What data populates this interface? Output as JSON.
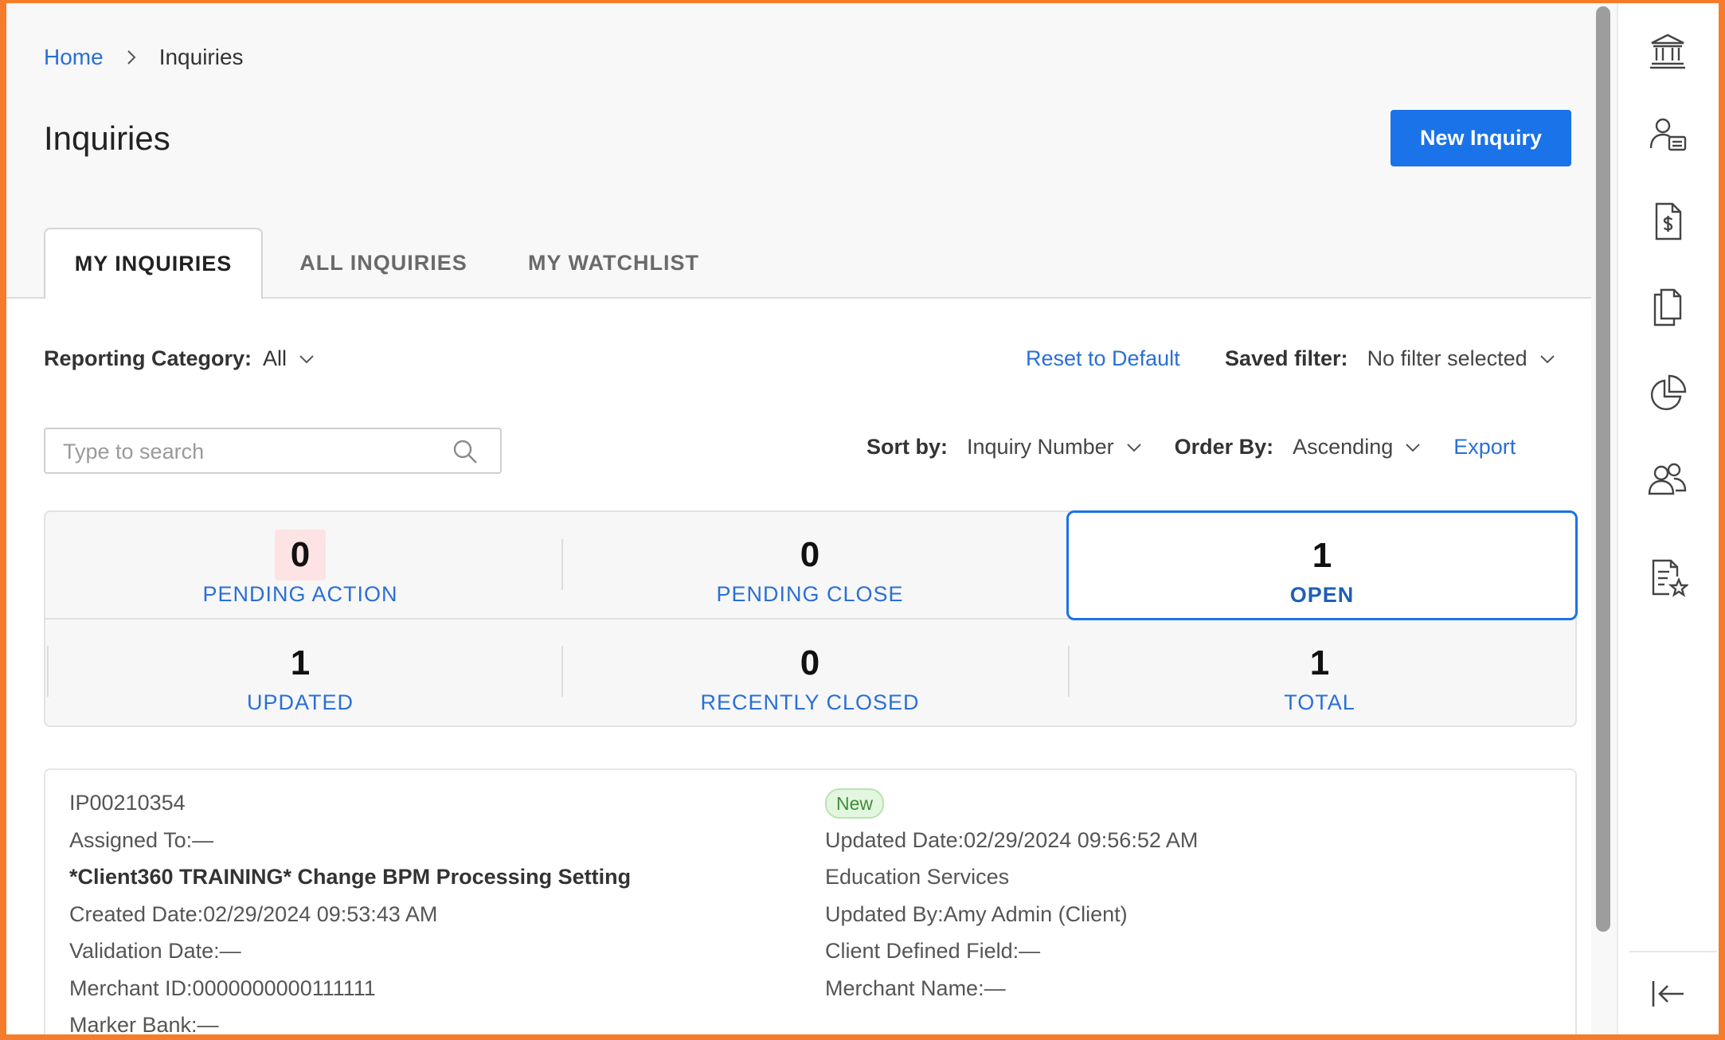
{
  "breadcrumb": {
    "home": "Home",
    "current": "Inquiries"
  },
  "page": {
    "title": "Inquiries",
    "new_button": "New Inquiry"
  },
  "tabs": [
    {
      "label": "MY INQUIRIES",
      "active": true
    },
    {
      "label": "ALL INQUIRIES",
      "active": false
    },
    {
      "label": "MY WATCHLIST",
      "active": false
    }
  ],
  "filters": {
    "reporting_category_label": "Reporting Category:",
    "reporting_category_value": "All",
    "reset_label": "Reset to Default",
    "saved_filter_label": "Saved filter:",
    "saved_filter_value": "No filter selected"
  },
  "search": {
    "placeholder": "Type to search",
    "value": ""
  },
  "sort": {
    "sort_label": "Sort by:",
    "sort_value": "Inquiry Number",
    "order_label": "Order By:",
    "order_value": "Ascending",
    "export_label": "Export"
  },
  "stats": [
    {
      "value": "0",
      "label": "PENDING ACTION"
    },
    {
      "value": "0",
      "label": "PENDING CLOSE"
    },
    {
      "value": "1",
      "label": "OPEN"
    },
    {
      "value": "1",
      "label": "UPDATED"
    },
    {
      "value": "0",
      "label": "RECENTLY CLOSED"
    },
    {
      "value": "1",
      "label": "TOTAL"
    }
  ],
  "inquiry": {
    "number": "IP00210354",
    "assigned_to": "Assigned To:—",
    "title": "*Client360 TRAINING* Change BPM Processing Setting",
    "created_date": "Created Date:02/29/2024 09:53:43 AM",
    "validation_date": "Validation Date:—",
    "merchant_id": "Merchant ID:0000000000111111",
    "marker_bank": "Marker Bank:—",
    "status": "New",
    "updated_date": "Updated Date:02/29/2024 09:56:52 AM",
    "category": "Education Services",
    "updated_by": "Updated By:Amy Admin (Client)",
    "client_defined_field": "Client Defined Field:—",
    "merchant_name": "Merchant Name:—"
  },
  "sidebar_icons": [
    "bank-icon",
    "user-card-icon",
    "invoice-dollar-icon",
    "documents-icon",
    "pie-chart-icon",
    "users-icon",
    "document-star-icon",
    "collapse-left-icon"
  ],
  "colors": {
    "accent": "#1a73e8",
    "link": "#2a6fd6",
    "frame": "#f57c2a",
    "badge_bg": "#e3f6df",
    "pending_highlight": "#fde3e3"
  }
}
